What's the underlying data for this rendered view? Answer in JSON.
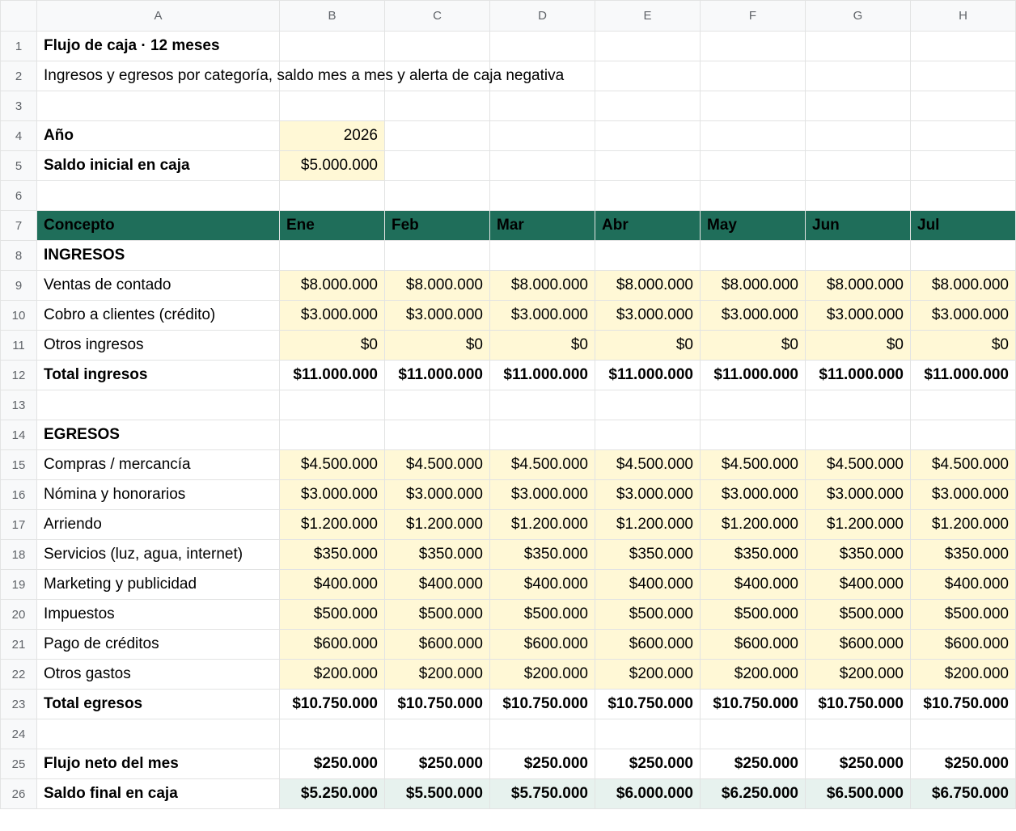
{
  "columns": [
    "A",
    "B",
    "C",
    "D",
    "E",
    "F",
    "G",
    "H"
  ],
  "title": "Flujo de caja · 12 meses",
  "subtitle": "Ingresos y egresos por categoría, saldo mes a mes y alerta de caja negativa",
  "params": {
    "year_label": "Año",
    "year_value": "2026",
    "opening_label": "Saldo inicial en caja",
    "opening_value": "$5.000.000"
  },
  "header": {
    "concept": "Concepto",
    "months": [
      "Ene",
      "Feb",
      "Mar",
      "Abr",
      "May",
      "Jun",
      "Jul"
    ]
  },
  "income": {
    "section_label": "INGRESOS",
    "rows": [
      {
        "label": "Ventas de contado",
        "values": [
          "$8.000.000",
          "$8.000.000",
          "$8.000.000",
          "$8.000.000",
          "$8.000.000",
          "$8.000.000",
          "$8.000.000"
        ]
      },
      {
        "label": "Cobro a clientes (crédito)",
        "values": [
          "$3.000.000",
          "$3.000.000",
          "$3.000.000",
          "$3.000.000",
          "$3.000.000",
          "$3.000.000",
          "$3.000.000"
        ]
      },
      {
        "label": "Otros ingresos",
        "values": [
          "$0",
          "$0",
          "$0",
          "$0",
          "$0",
          "$0",
          "$0"
        ]
      }
    ],
    "total_label": "Total ingresos",
    "total_values": [
      "$11.000.000",
      "$11.000.000",
      "$11.000.000",
      "$11.000.000",
      "$11.000.000",
      "$11.000.000",
      "$11.000.000"
    ]
  },
  "expenses": {
    "section_label": "EGRESOS",
    "rows": [
      {
        "label": "Compras / mercancía",
        "values": [
          "$4.500.000",
          "$4.500.000",
          "$4.500.000",
          "$4.500.000",
          "$4.500.000",
          "$4.500.000",
          "$4.500.000"
        ]
      },
      {
        "label": "Nómina y honorarios",
        "values": [
          "$3.000.000",
          "$3.000.000",
          "$3.000.000",
          "$3.000.000",
          "$3.000.000",
          "$3.000.000",
          "$3.000.000"
        ]
      },
      {
        "label": "Arriendo",
        "values": [
          "$1.200.000",
          "$1.200.000",
          "$1.200.000",
          "$1.200.000",
          "$1.200.000",
          "$1.200.000",
          "$1.200.000"
        ]
      },
      {
        "label": "Servicios (luz, agua, internet)",
        "values": [
          "$350.000",
          "$350.000",
          "$350.000",
          "$350.000",
          "$350.000",
          "$350.000",
          "$350.000"
        ]
      },
      {
        "label": "Marketing y publicidad",
        "values": [
          "$400.000",
          "$400.000",
          "$400.000",
          "$400.000",
          "$400.000",
          "$400.000",
          "$400.000"
        ]
      },
      {
        "label": "Impuestos",
        "values": [
          "$500.000",
          "$500.000",
          "$500.000",
          "$500.000",
          "$500.000",
          "$500.000",
          "$500.000"
        ]
      },
      {
        "label": "Pago de créditos",
        "values": [
          "$600.000",
          "$600.000",
          "$600.000",
          "$600.000",
          "$600.000",
          "$600.000",
          "$600.000"
        ]
      },
      {
        "label": "Otros gastos",
        "values": [
          "$200.000",
          "$200.000",
          "$200.000",
          "$200.000",
          "$200.000",
          "$200.000",
          "$200.000"
        ]
      }
    ],
    "total_label": "Total egresos",
    "total_values": [
      "$10.750.000",
      "$10.750.000",
      "$10.750.000",
      "$10.750.000",
      "$10.750.000",
      "$10.750.000",
      "$10.750.000"
    ]
  },
  "net_flow": {
    "label": "Flujo neto del mes",
    "values": [
      "$250.000",
      "$250.000",
      "$250.000",
      "$250.000",
      "$250.000",
      "$250.000",
      "$250.000"
    ]
  },
  "closing_balance": {
    "label": "Saldo final en caja",
    "values": [
      "$5.250.000",
      "$5.500.000",
      "$5.750.000",
      "$6.000.000",
      "$6.250.000",
      "$6.500.000",
      "$6.750.000"
    ]
  },
  "colors": {
    "header_bg": "#1f6e5a",
    "input_bg": "#fff8d6",
    "input_text": "#1a1aff",
    "final_bg": "#e7f2ee",
    "title": "#1f6e5a"
  }
}
